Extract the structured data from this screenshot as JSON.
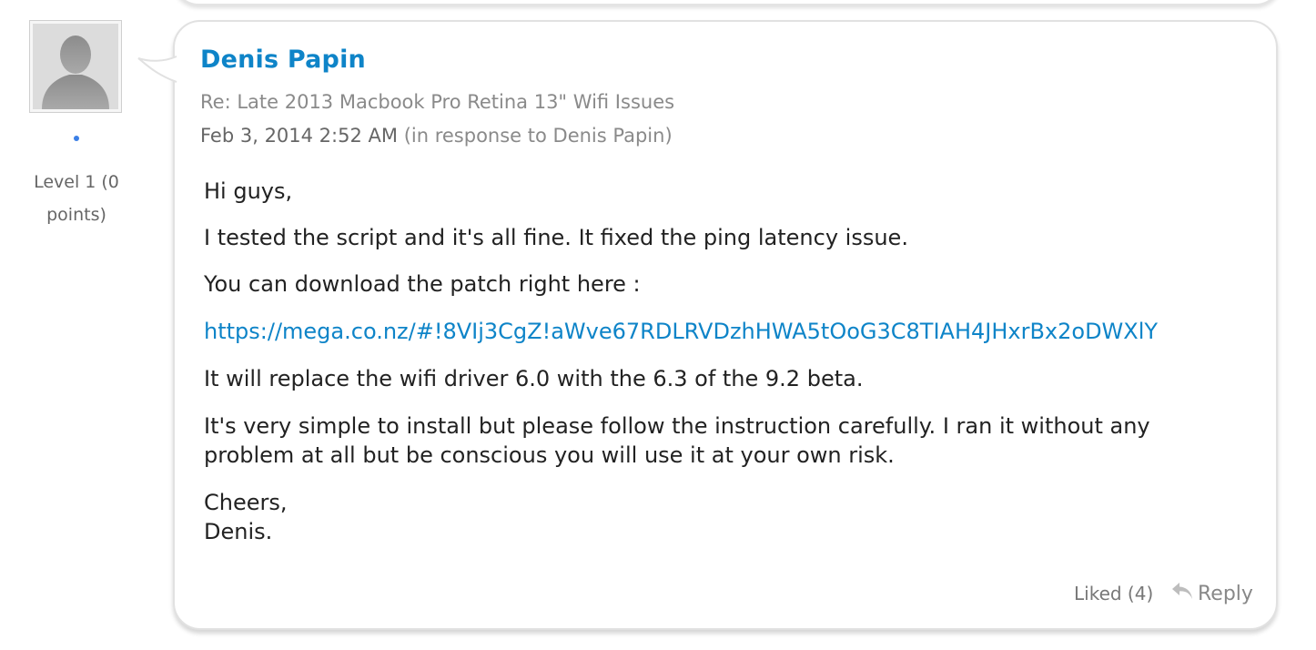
{
  "author": {
    "name": "Denis Papin",
    "level_text": [
      "Level 1 (0",
      "points)"
    ],
    "avatar_icon": "user-silhouette-icon",
    "status_color": "#3b7fe6"
  },
  "post": {
    "subject": "Re: Late 2013 Macbook Pro Retina 13\" Wifi Issues",
    "date": "Feb 3, 2014 2:52 AM",
    "in_response": "(in response to Denis Papin)",
    "body": {
      "greeting": "Hi guys,",
      "p1": "I tested the script and it's all fine. It fixed the ping latency issue.",
      "p2": "You can download the patch right here :",
      "link": "https://mega.co.nz/#!8VIj3CgZ!aWve67RDLRVDzhHWA5tOoG3C8TIAH4JHxrBx2oDWXlY",
      "p3": "It will replace the wifi driver 6.0 with the 6.3 of the 9.2 beta.",
      "p4": "It's very simple to install but please follow the instruction carefully. I ran it without any problem at all but be conscious you will use it at your own risk.",
      "signoff1": "Cheers,",
      "signoff2": "Denis."
    }
  },
  "actions": {
    "liked": "Liked (4)",
    "reply": "Reply",
    "reply_icon": "reply-arrow-icon"
  },
  "colors": {
    "accent": "#0e84c8",
    "muted": "#8a8a8a"
  }
}
